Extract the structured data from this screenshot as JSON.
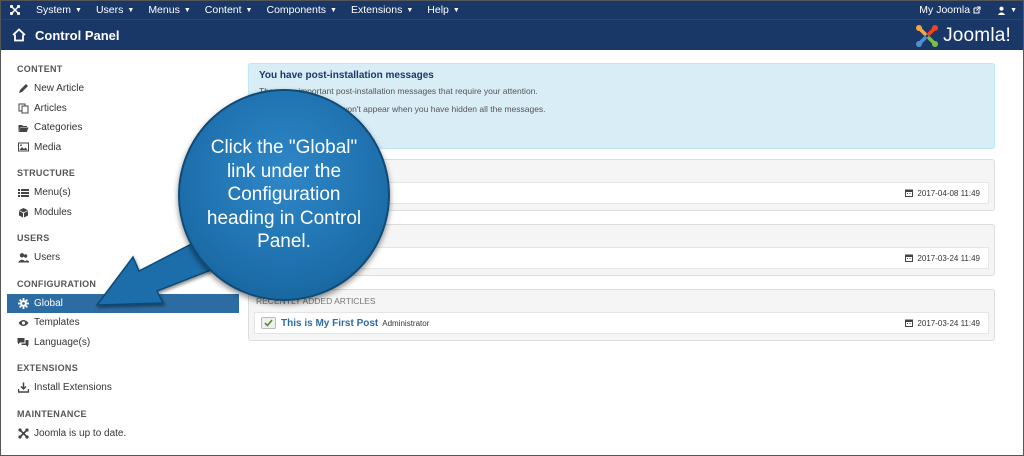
{
  "navbar": {
    "menu": [
      "System",
      "Users",
      "Menus",
      "Content",
      "Components",
      "Extensions",
      "Help"
    ],
    "right_menu": "My Joomla",
    "user_caret": "▾"
  },
  "header": {
    "title": "Control Panel",
    "brand": "Joomla!"
  },
  "sidebar": {
    "content_head": "CONTENT",
    "content_items": [
      "New Article",
      "Articles",
      "Categories",
      "Media"
    ],
    "structure_head": "STRUCTURE",
    "structure_items": [
      "Menu(s)",
      "Modules"
    ],
    "users_head": "USERS",
    "users_items": [
      "Users"
    ],
    "config_head": "CONFIGURATION",
    "config_items": [
      "Global",
      "Templates",
      "Language(s)"
    ],
    "extensions_head": "EXTENSIONS",
    "extensions_items": [
      "Install Extensions"
    ],
    "maintenance_head": "MAINTENANCE",
    "maintenance_items": [
      "Joomla is up to date."
    ]
  },
  "alert": {
    "title": "You have post-installation messages",
    "line1": "There are important post-installation messages that require your attention.",
    "line2": "This information area won't appear when you have hidden all the messages."
  },
  "panels": [
    {
      "date": "2017-04-08 11:49"
    },
    {
      "date": "2017-03-24 11:49"
    },
    {
      "heading": "RECENTLY ADDED ARTICLES",
      "article_title": "This is My First Post",
      "article_author": "Administrator",
      "date": "2017-03-24 11:49"
    }
  ],
  "callout": {
    "text": "Click the \"Global\" link under the Configuration heading in Control Panel."
  },
  "colors": {
    "nav_bg": "#1a3867",
    "active_bg": "#2d6ca2",
    "callout_blue": "#1c6eaa",
    "alert_bg": "#d9edf7"
  }
}
